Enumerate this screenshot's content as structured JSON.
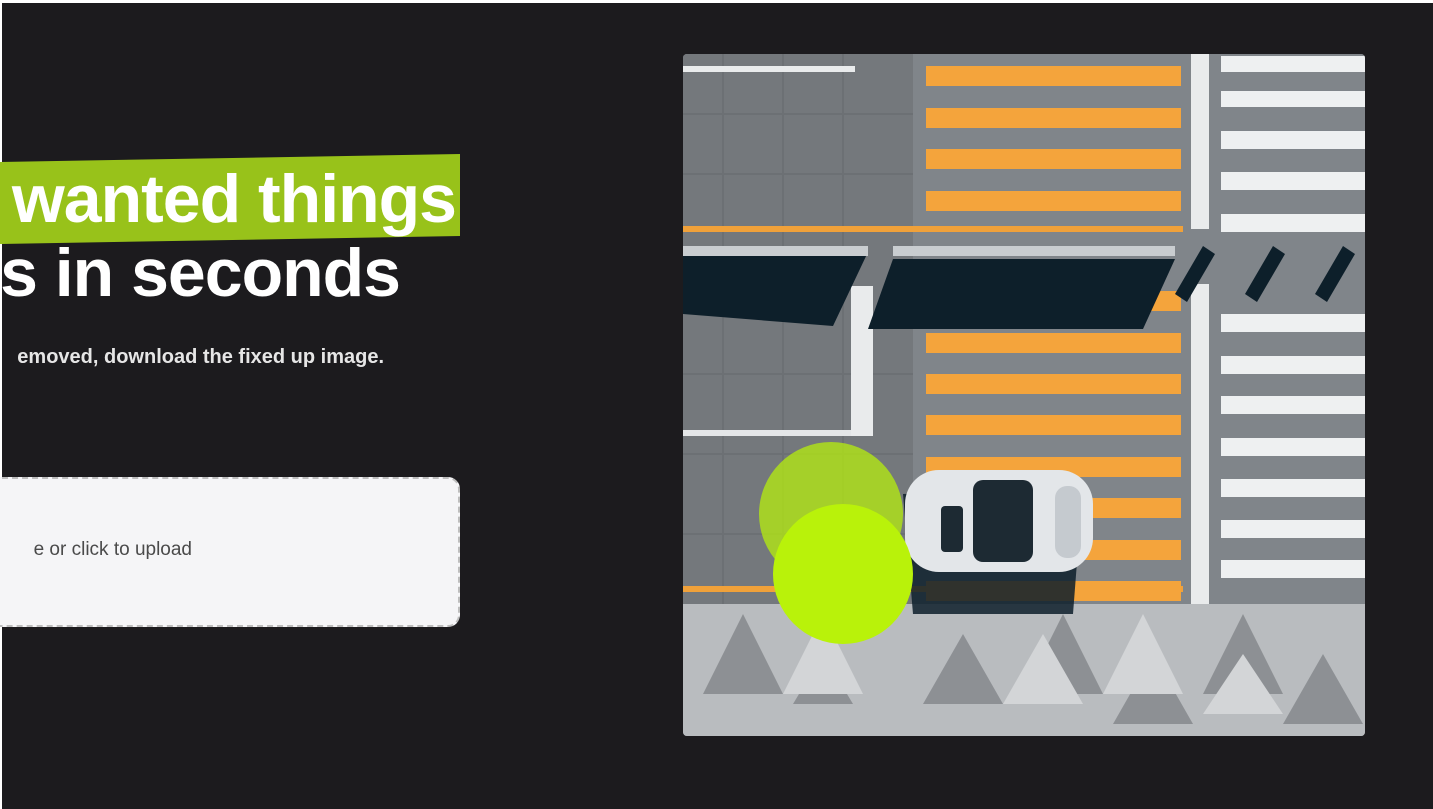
{
  "hero": {
    "headline_line1": "wanted things",
    "headline_line2": "s in seconds",
    "subtitle": "emoved, download the fixed up image."
  },
  "upload": {
    "prompt": "e or click to upload"
  },
  "colors": {
    "background": "#1c1b1e",
    "accent": "#98c21a",
    "brush": "#b9f20a",
    "dropzone": "#f5f5f7"
  },
  "demo_image": {
    "icon": "aerial-street-car-photo"
  }
}
